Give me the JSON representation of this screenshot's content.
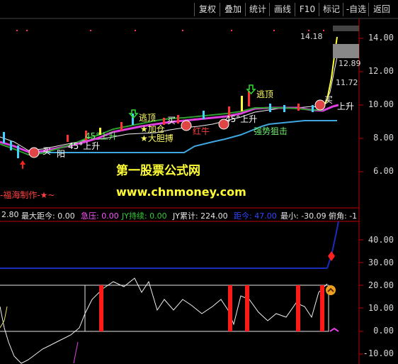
{
  "toolbar": {
    "buttons": [
      "复权",
      "叠加",
      "统计",
      "画线",
      "F10",
      "标记",
      "-自选",
      "返回"
    ]
  },
  "main_chart": {
    "watermark_title": "第一股票公式网",
    "watermark_url": "www.chnmoney.com",
    "credit": "-福海制作-★~",
    "y_axis_labels": [
      "14.00",
      "12.00",
      "10.00",
      "8.00",
      "6.00"
    ],
    "high_marker": "14.18",
    "price_tags": [
      "12.89",
      "11.72"
    ],
    "annotations": {
      "escape_top_1": "逃顶",
      "escape_top_2": "逃顶",
      "add_position": "★加仓",
      "bold_attack": "★大胆搏",
      "buy_1": "买",
      "buy_2": "买",
      "buy_3": "买",
      "rise_45_1": "45°上升",
      "rise_45_2": "45°上升",
      "rise_45_3": "45°上升",
      "rise_final": "上升",
      "red_bull": "红牛",
      "strong_snipe": "强势狙击",
      "bullish": "阳"
    }
  },
  "indicator": {
    "values": [
      {
        "text": "2.80",
        "color": "#e6e6e6"
      },
      {
        "text": "最大距今: 0.00",
        "color": "#e6e6e6"
      },
      {
        "text": "急压: 0.00",
        "color": "#ff55ff"
      },
      {
        "text": "JY持续: 0.00",
        "color": "#33cc33"
      },
      {
        "text": "JY累计: 224.00",
        "color": "#e6e6e6"
      },
      {
        "text": "距今: 47.00",
        "color": "#3344ff"
      },
      {
        "text": "最小: -30.09",
        "color": "#e6e6e6"
      },
      {
        "text": "俯角: -1",
        "color": "#e6e6e6"
      }
    ],
    "y_axis_labels": [
      "40.00",
      "30.00",
      "20.00",
      "10.00",
      "0.00",
      "-10.00"
    ]
  },
  "colors": {
    "price_axis": "#ff3333",
    "grid_border": "#c00000",
    "support_line": "#3fa7e0",
    "ma_magenta": "#e040e0",
    "blue_hline": "#1a2db8"
  }
}
